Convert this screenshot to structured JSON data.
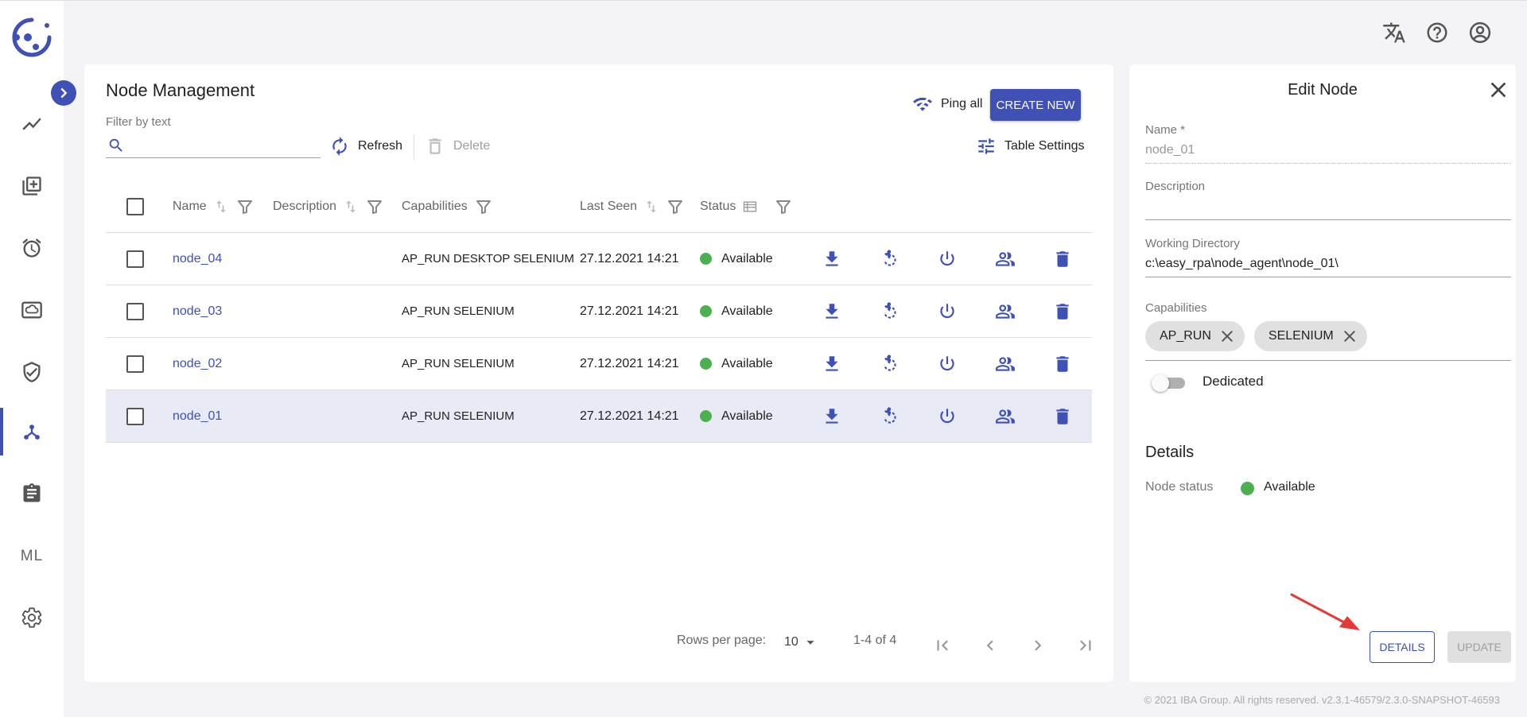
{
  "app": {
    "copyright": "© 2021 IBA Group. All rights reserved. v2.3.1-46579/2.3.0-SNAPSHOT-46593"
  },
  "sidebar": {
    "items": [
      {
        "icon": "chart-line-icon"
      },
      {
        "icon": "library-add-icon"
      },
      {
        "icon": "alarm-clock-icon"
      },
      {
        "icon": "cloud-storage-icon"
      },
      {
        "icon": "shield-check-icon"
      },
      {
        "icon": "nodes-icon",
        "active": true
      },
      {
        "icon": "clipboard-icon"
      },
      {
        "label": "ML"
      },
      {
        "icon": "gear-icon"
      }
    ]
  },
  "header": {
    "icons": [
      "translate-icon",
      "help-icon",
      "account-icon"
    ]
  },
  "main": {
    "title": "Node Management",
    "filter": {
      "label": "Filter by text",
      "value": "",
      "placeholder": ""
    },
    "toolbar": {
      "refresh_label": "Refresh",
      "delete_label": "Delete",
      "ping_all_label": "Ping all",
      "create_new_label": "CREATE NEW",
      "table_settings_label": "Table Settings"
    },
    "table": {
      "columns": [
        "Name",
        "Description",
        "Capabilities",
        "Last Seen",
        "Status"
      ],
      "rows": [
        {
          "name": "node_04",
          "description": "",
          "capabilities": "AP_RUN DESKTOP SELENIUM",
          "last_seen": "27.12.2021 14:21",
          "status": "Available",
          "selected": false
        },
        {
          "name": "node_03",
          "description": "",
          "capabilities": "AP_RUN SELENIUM",
          "last_seen": "27.12.2021 14:21",
          "status": "Available",
          "selected": false
        },
        {
          "name": "node_02",
          "description": "",
          "capabilities": "AP_RUN SELENIUM",
          "last_seen": "27.12.2021 14:21",
          "status": "Available",
          "selected": false
        },
        {
          "name": "node_01",
          "description": "",
          "capabilities": "AP_RUN SELENIUM",
          "last_seen": "27.12.2021 14:21",
          "status": "Available",
          "selected": true
        }
      ],
      "status_color": "#4caf50"
    },
    "pagination": {
      "rows_per_page_label": "Rows per page:",
      "rows_per_page": "10",
      "range": "1-4 of 4"
    }
  },
  "edit_panel": {
    "title": "Edit Node",
    "name_label": "Name *",
    "name_value": "node_01",
    "description_label": "Description",
    "description_value": "",
    "working_dir_label": "Working Directory",
    "working_dir_value": "c:\\easy_rpa\\node_agent\\node_01\\",
    "capabilities_label": "Capabilities",
    "capabilities": [
      "AP_RUN",
      "SELENIUM"
    ],
    "dedicated_label": "Dedicated",
    "dedicated": false,
    "details_title": "Details",
    "node_status_label": "Node status",
    "node_status_value": "Available",
    "details_button": "DETAILS",
    "update_button": "UPDATE"
  },
  "colors": {
    "accent": "#3f51b5",
    "status_available": "#4caf50",
    "annotation_arrow": "#e53935"
  }
}
